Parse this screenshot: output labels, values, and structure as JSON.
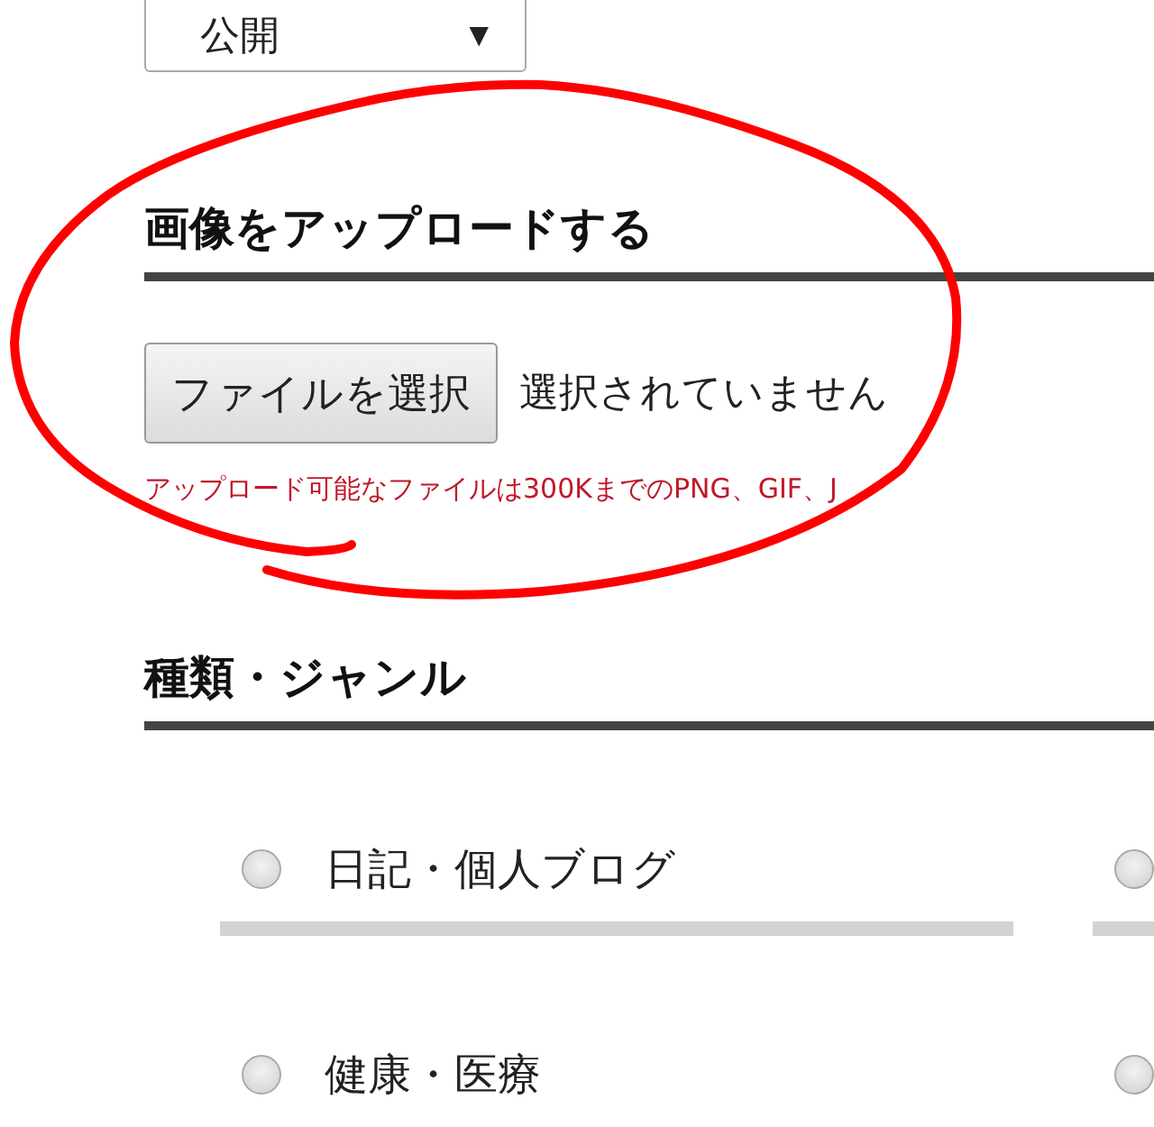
{
  "visibility_select": {
    "value": "公開",
    "arrow": "▼"
  },
  "upload_section": {
    "heading": "画像をアップロードする",
    "file_button": "ファイルを選択",
    "file_status": "選択されていません",
    "note": "アップロード可能なファイルは300KまでのPNG、GIF、J"
  },
  "genre_section": {
    "heading": "種類・ジャンル",
    "options": [
      {
        "label": "日記・個人ブログ",
        "selected": false
      },
      {
        "selected": false
      },
      {
        "label": "健康・医療",
        "selected": false
      },
      {
        "selected": false
      }
    ]
  },
  "annotation": {
    "kind": "freehand-circle",
    "color": "#ff0000"
  }
}
